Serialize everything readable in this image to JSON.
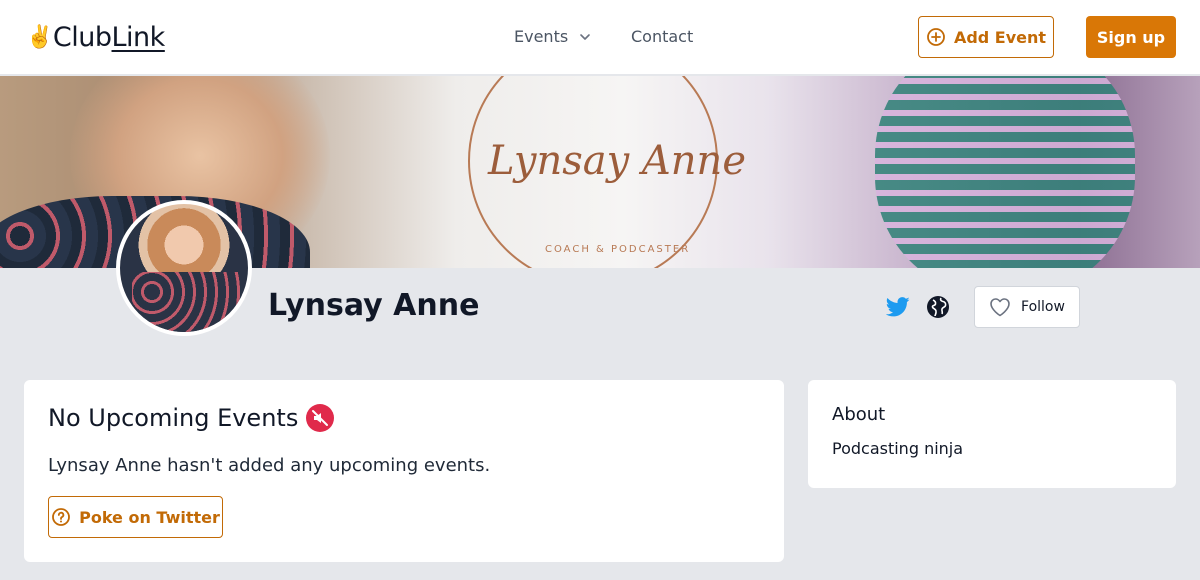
{
  "header": {
    "logo": {
      "emoji": "✌️",
      "club": "Club",
      "link": "Link"
    },
    "nav": {
      "events_label": "Events",
      "contact_label": "Contact"
    },
    "add_event_label": "Add Event",
    "signup_label": "Sign up"
  },
  "banner": {
    "script_text": "Lynsay Anne",
    "subtitle": "COACH & PODCASTER"
  },
  "profile": {
    "name": "Lynsay Anne",
    "follow_label": "Follow",
    "icons": [
      "twitter-icon",
      "globe-icon",
      "heart-icon"
    ]
  },
  "events_card": {
    "title": "No Upcoming Events",
    "status_icon": "muted-speaker-icon",
    "message": "Lynsay Anne hasn't added any upcoming events.",
    "poke_label": "Poke on Twitter"
  },
  "about_card": {
    "heading": "About",
    "text": "Podcasting ninja"
  },
  "colors": {
    "accent": "#d97706",
    "accent_outline": "#c26a06",
    "twitter_blue": "#1d9bf0",
    "page_bg": "#e5e7eb",
    "mute_red": "#e02a4b"
  }
}
